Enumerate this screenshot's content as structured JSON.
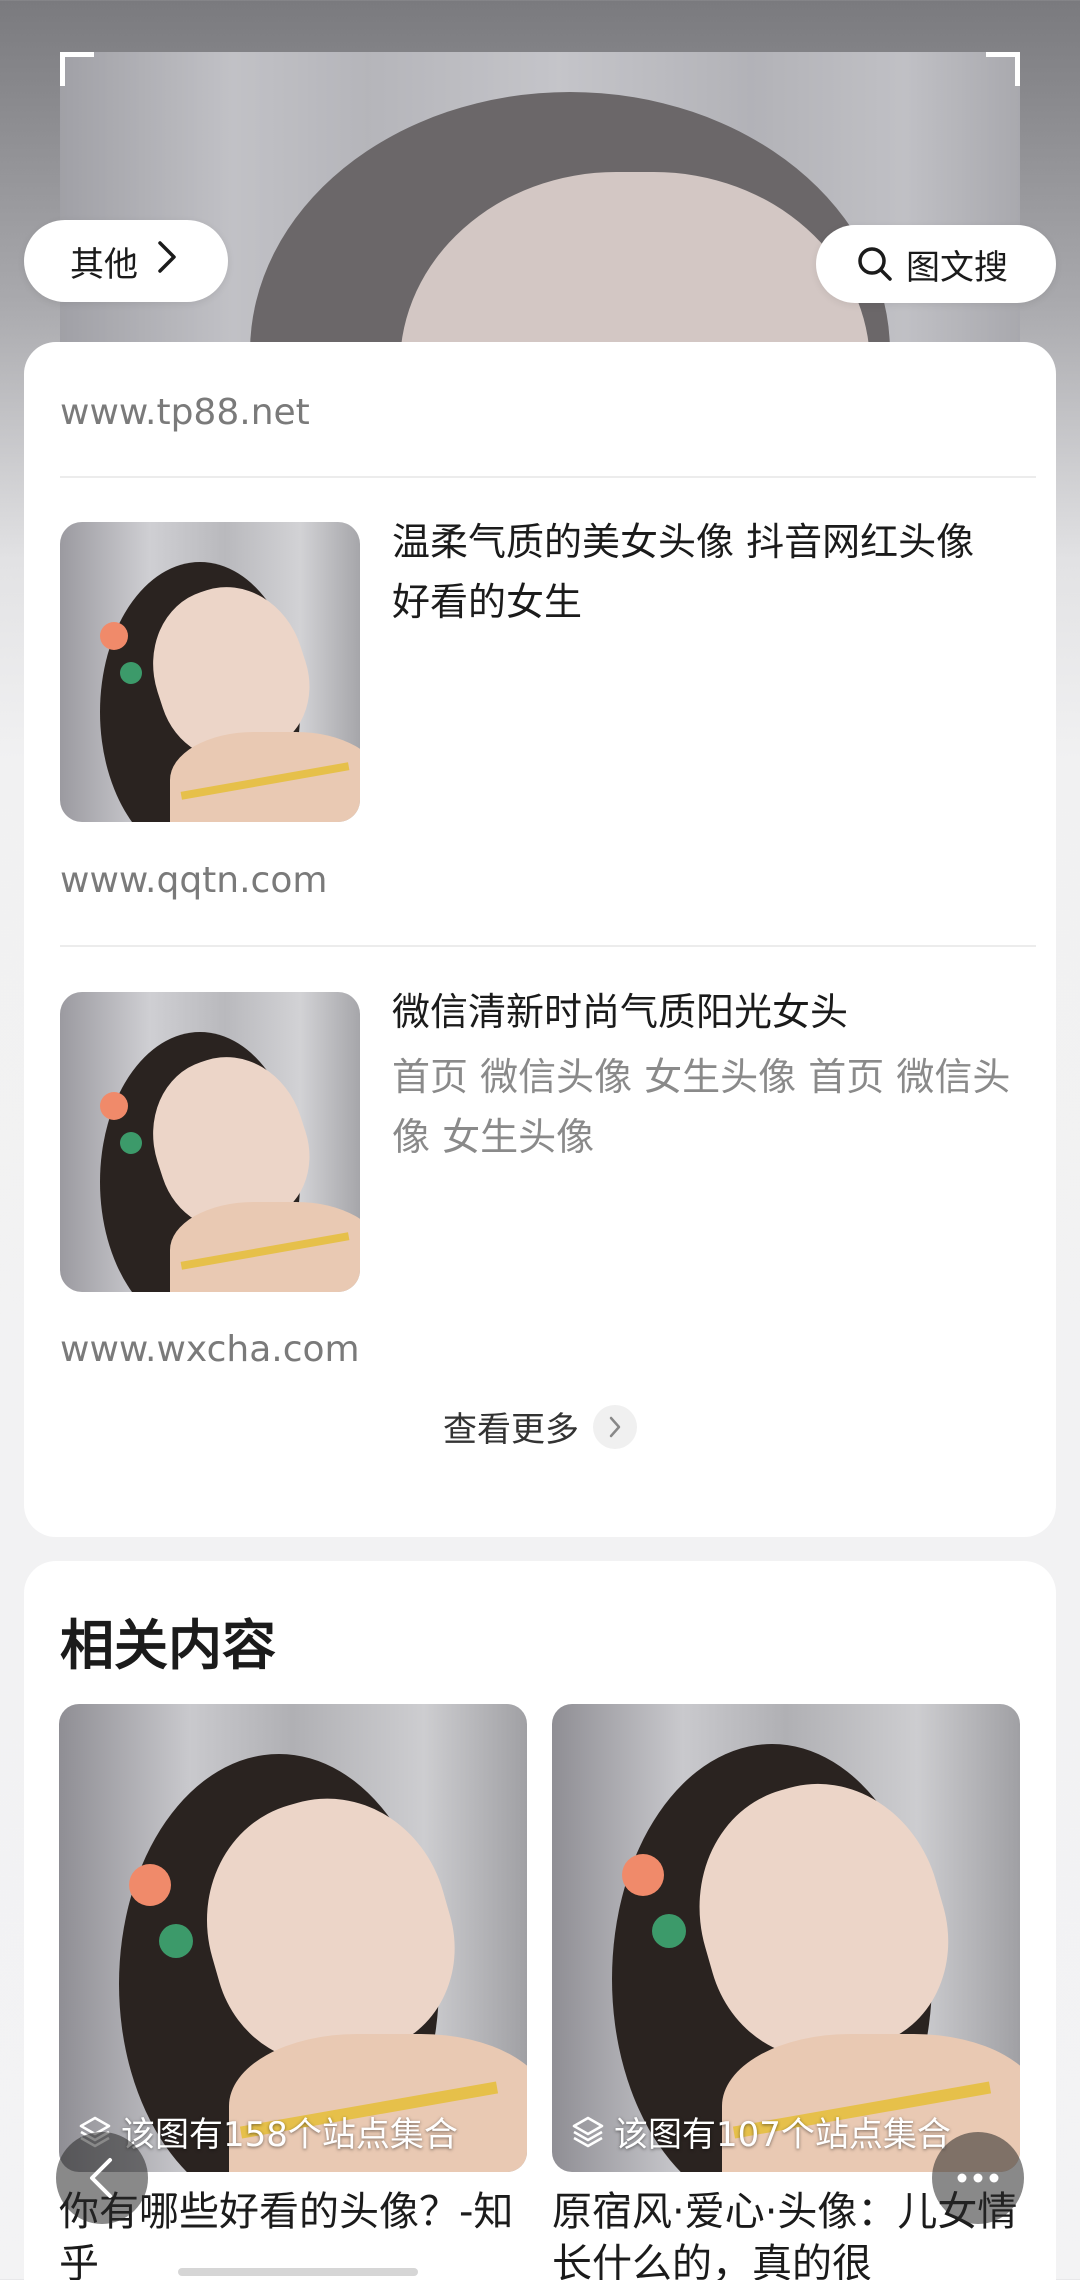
{
  "top": {
    "category_label": "其他",
    "search_label": "图文搜"
  },
  "results": {
    "first_source": "www.tp88.net",
    "items": [
      {
        "title": "温柔气质的美女头像 抖音网红头像好看的女生",
        "description": "",
        "source": "www.qqtn.com"
      },
      {
        "title": "微信清新时尚气质阳光女头",
        "description": "首页 微信头像 女生头像 首页 微信头像 女生头像",
        "source": "www.wxcha.com"
      }
    ],
    "more_label": "查看更多"
  },
  "related": {
    "title": "相关内容",
    "items": [
      {
        "badge": "该图有158个站点集合",
        "caption": "你有哪些好看的头像？-知乎"
      },
      {
        "badge": "该图有107个站点集合",
        "caption": "原宿风·爱心·头像：儿女情长什么的，真的很"
      }
    ]
  },
  "icons": {
    "chevron": "chevron-right-icon",
    "search": "search-icon",
    "layers": "layers-icon",
    "back": "back-arrow-icon",
    "menu": "more-dots-icon"
  }
}
